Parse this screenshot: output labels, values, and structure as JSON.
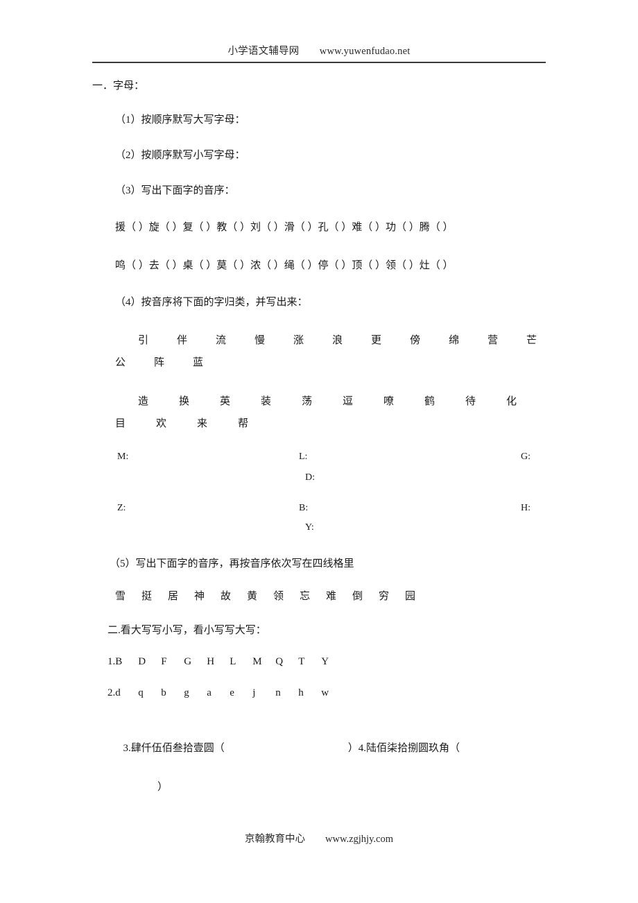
{
  "header": {
    "site_name": "小学语文辅导网",
    "url": "www.yuwenfudao.net",
    "line": "小学语文辅导网　　www.yuwenfudao.net"
  },
  "footer": {
    "org_name": "京翰教育中心",
    "url": "www.zgjhjy.com",
    "line": "京翰教育中心　　www.zgjhjy.com"
  },
  "sections": {
    "one": {
      "title": "一．字母：",
      "items": {
        "q1": "（1）按顺序默写大写字母：",
        "q2": "（2）按顺序默写小写字母：",
        "q3": "（3）写出下面字的音序：",
        "q4": "（4）按音序将下面的字归类，并写出来：",
        "q5": "（5）写出下面字的音序，再按音序依次写在四线格里"
      },
      "yinxu_row1": "援（  ）旋（  ）复（  ）教（  ）刘（  ）滑（  ）孔（  ）难（  ）功（  ）腾（  ）",
      "yinxu_row2": "鸣（  ）去（  ）桌（  ）莫（  ）浓（  ）绳（  ）停（  ）顶（  ）领（  ）灶（  ）",
      "classify_chars_1": [
        "引",
        "伴",
        "流",
        "慢",
        "涨",
        "浪",
        "更",
        "傍",
        "绵",
        "营",
        "芒",
        "公",
        "阵",
        "蓝"
      ],
      "classify_chars_2": [
        "造",
        "换",
        "英",
        "装",
        "荡",
        "逗",
        "嘹",
        "鹤",
        "待",
        "化",
        "目",
        "欢",
        "来",
        "帮"
      ],
      "answer_labels": {
        "m": "M:",
        "l": "L:",
        "g": "G:",
        "d": "D:",
        "z": "Z:",
        "b": "B:",
        "h": "H:",
        "y": "Y:"
      },
      "sequence_chars": [
        "雪",
        "挺",
        "居",
        "神",
        "故",
        "黄",
        "领",
        "忘",
        "难",
        "倒",
        "穷",
        "园"
      ]
    },
    "two": {
      "title": "二.看大写写小写，看小写写大写：",
      "line1_label": "1.",
      "line1_letters": [
        "B",
        "D",
        "F",
        "G",
        "H",
        "L",
        "M",
        "Q",
        "T",
        "Y"
      ],
      "line2_label": "2.",
      "line2_letters": [
        "d",
        "q",
        "b",
        "g",
        "a",
        "e",
        "j",
        "n",
        "h",
        "w"
      ],
      "money_line": "3.肆仟伍佰叁拾壹圆（",
      "money_mid": "）4.陆佰柒拾捌圆玖角（",
      "money_close": "）"
    }
  }
}
